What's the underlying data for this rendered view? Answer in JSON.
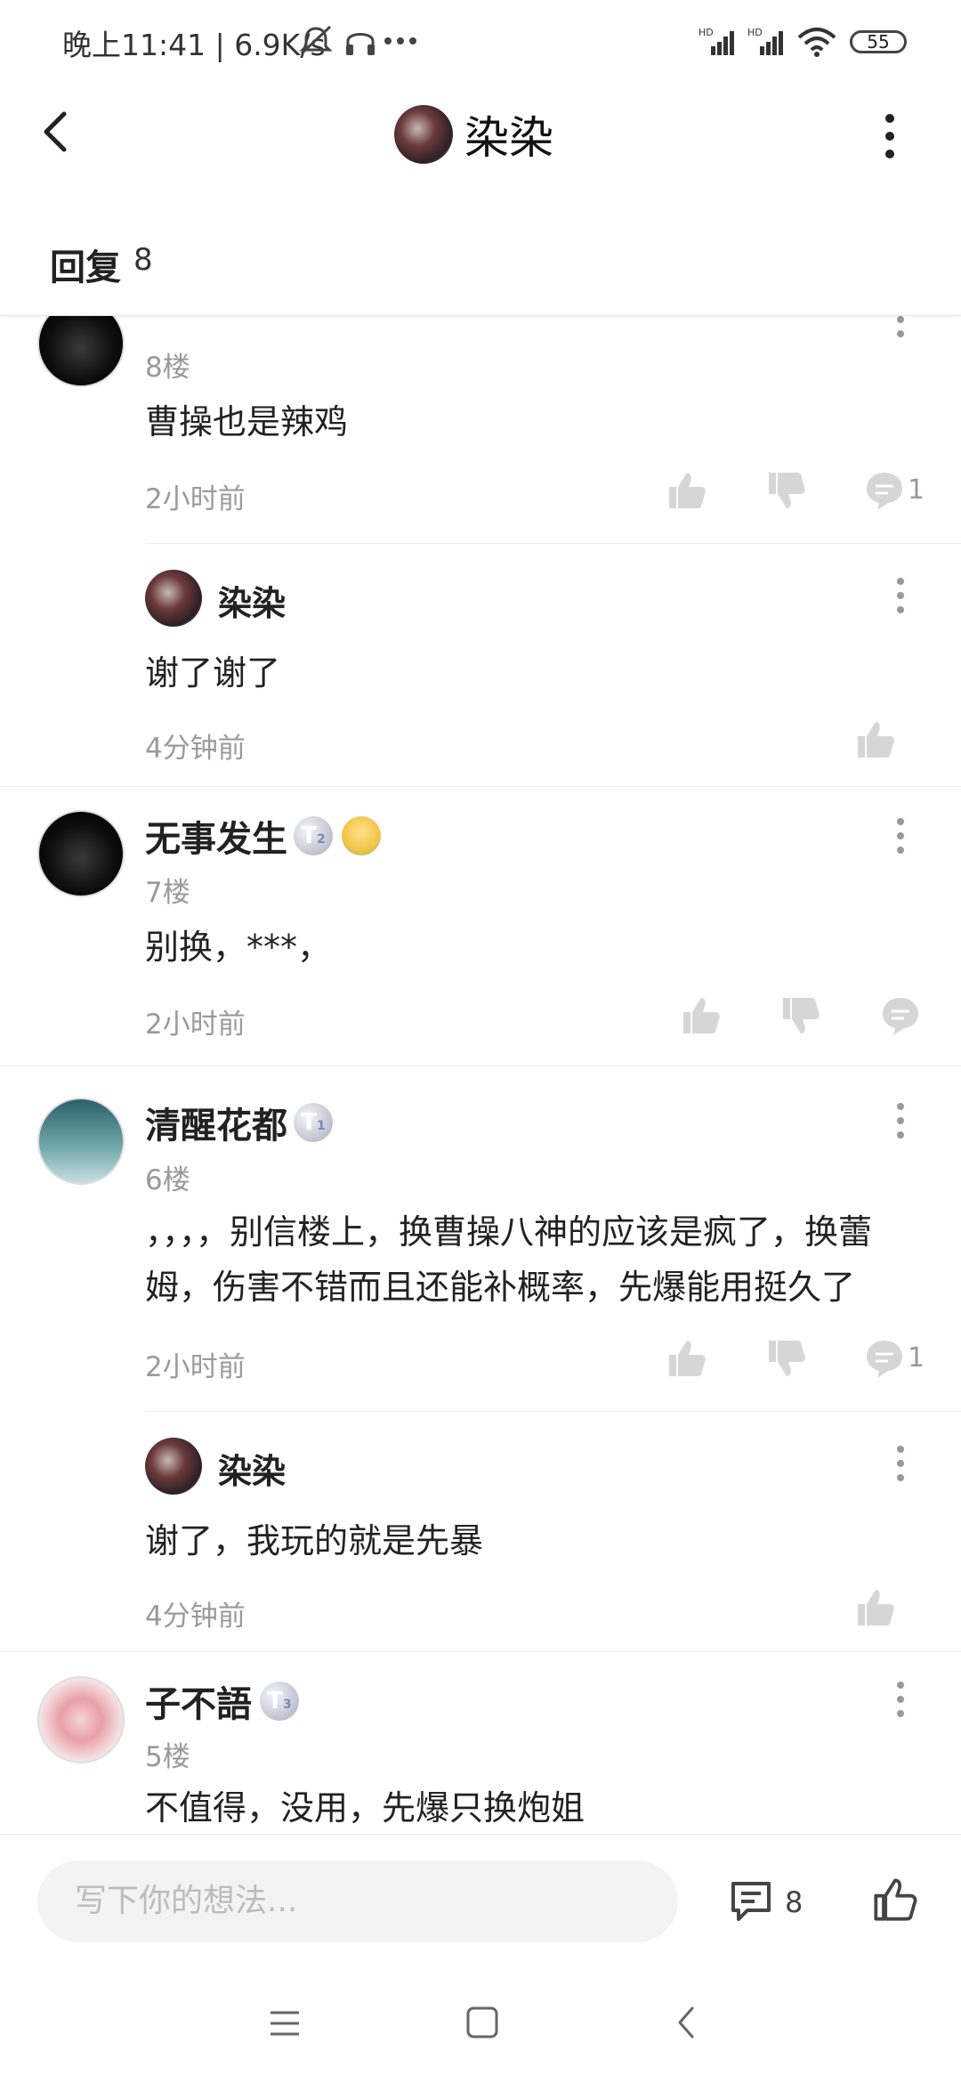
{
  "status_bar": {
    "time_text": "晚上11:41 | 6.9K/s",
    "battery": "55"
  },
  "header": {
    "title": "染染"
  },
  "reply_header": {
    "label": "回复",
    "count": "8"
  },
  "comments": [
    {
      "floor": "8楼",
      "text": "曹操也是辣鸡",
      "time": "2小时前",
      "reply_count": "1",
      "reply": {
        "user": "染染",
        "text": "谢了谢了",
        "time": "4分钟前"
      }
    },
    {
      "user": "无事发生",
      "badge": "T",
      "badge_sub": "2",
      "floor": "7楼",
      "text": "别换，***，",
      "time": "2小时前"
    },
    {
      "user": "清醒花都",
      "badge": "T",
      "badge_sub": "1",
      "floor": "6楼",
      "text": "，，，，别信楼上，换曹操八神的应该是疯了，换蕾姆，伤害不错而且还能补概率，先爆能用挺久了",
      "time": "2小时前",
      "reply_count": "1",
      "reply": {
        "user": "染染",
        "text": "谢了，我玩的就是先暴",
        "time": "4分钟前"
      }
    },
    {
      "user": "子不語",
      "badge": "T",
      "badge_sub": "3",
      "floor": "5楼",
      "text": "不值得，没用，先爆只换炮姐"
    }
  ],
  "bottom_bar": {
    "input_placeholder": "写下你的想法...",
    "comment_count": "8"
  }
}
